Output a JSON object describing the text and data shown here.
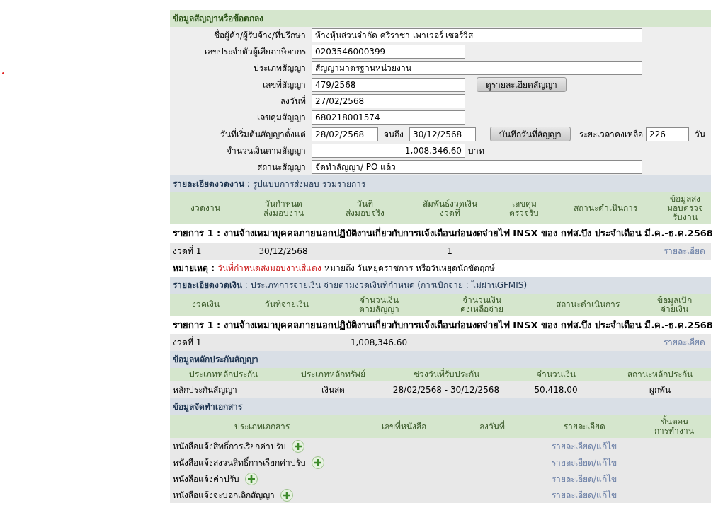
{
  "contract": {
    "title": "ข้อมูลสัญญาหรือข้อตกลง",
    "fields": [
      {
        "kind": "wide",
        "label": "ชื่อผู้ค้า/ผู้รับจ้าง/ที่ปรึกษา",
        "value": "ห้างหุ้นส่วนจำกัด ศรีราชา เพาเวอร์ เซอร์วิส"
      },
      {
        "kind": "narrow",
        "label": "เลขประจำตัวผู้เสียภาษีอากร",
        "value": "0203546000399"
      },
      {
        "kind": "wide",
        "label": "ประเภทสัญญา",
        "value": "สัญญามาตรฐานหน่วยงาน"
      },
      {
        "kind": "button",
        "label": "เลขที่สัญญา",
        "value": "479/2568",
        "button": "ดูรายละเอียดสัญญา"
      },
      {
        "kind": "narrow",
        "label": "ลงวันที่",
        "value": "27/02/2568"
      },
      {
        "kind": "narrow",
        "label": "เลขคุมสัญญา",
        "value": "680218001574"
      },
      {
        "kind": "range",
        "label": "วันที่เริ่มต้นสัญญาตั้งแต่",
        "value": "28/02/2568",
        "to_label": "จนถึง",
        "to_value": "30/12/2568",
        "button": "บันทึกวันที่สัญญา",
        "remaining_label": "ระยะเวลาคงเหลือ",
        "remaining_value": "226",
        "unit": "วัน"
      },
      {
        "kind": "amount",
        "label": "จำนวนเงินตามสัญญา",
        "value": "1,008,346.60",
        "unit": "บาท"
      },
      {
        "kind": "wide",
        "label": "สถานะสัญญา",
        "value": "จัดทำสัญญา/ PO แล้ว"
      }
    ]
  },
  "work": {
    "title": "รายละเอียดงวดงาน",
    "subtitle": ": รูปแบบการส่งมอบ รวมรายการ",
    "columns": [
      "งวดงาน",
      "วันกำหนด\nส่งมอบงาน",
      "วันที่\nส่งมอบจริง",
      "สัมพันธ์งวดเงิน\nงวดที่",
      "เลขคุม\nตรวจรับ",
      "สถานะดำเนินการ",
      "ข้อมูลส่ง\nมอบตรวจ\nรับงาน"
    ],
    "item_title": "รายการ 1 : งานจ้างเหมาบุคคลภายนอกปฏิบัติงานเกี่ยวกับการแจ้งเตือนก่อนงดจ่ายไฟ INSX ของ กฟส.บึง ประจำเดือน มี.ค.-ธ.ค.2568",
    "rows": [
      {
        "cells": [
          "งวดที่ 1",
          "30/12/2568",
          "",
          "1",
          "",
          ""
        ],
        "link": "รายละเอียด"
      }
    ]
  },
  "note": {
    "label": "หมายเหตุ :",
    "highlight": "วันที่กำหนดส่งมอบงานสีแดง",
    "text": "หมายถึง วันหยุดราชการ หรือวันหยุดนักขัตฤกษ์"
  },
  "payment": {
    "title": "รายละเอียดงวดเงิน",
    "subtitle": ": ประเภทการจ่ายเงิน จ่ายตามงวดเงินที่กำหนด (การเบิกจ่าย : ไม่ผ่านGFMIS)",
    "columns": [
      "งวดเงิน",
      "วันที่จ่ายเงิน",
      "จำนวนเงิน\nตามสัญญา",
      "จำนวนเงิน\nคงเหลือจ่าย",
      "สถานะดำเนินการ",
      "ข้อมูลเบิก\nจ่ายเงิน"
    ],
    "item_title": "รายการ 1 : งานจ้างเหมาบุคคลภายนอกปฏิบัติงานเกี่ยวกับการแจ้งเตือนก่อนงดจ่ายไฟ INSX ของ กฟส.บึง ประจำเดือน มี.ค.-ธ.ค.2568",
    "rows": [
      {
        "cells": [
          "งวดที่ 1",
          "",
          "1,008,346.60",
          "",
          ""
        ],
        "link": "รายละเอียด"
      }
    ]
  },
  "guarantee": {
    "title": "ข้อมูลหลักประกันสัญญา",
    "columns": [
      "ประเภทหลักประกัน",
      "ประเภทหลักทรัพย์",
      "ช่วงวันที่รับประกัน",
      "จำนวนเงิน",
      "สถานะหลักประกัน"
    ],
    "rows": [
      {
        "cells": [
          "หลักประกันสัญญา",
          "เงินสด",
          "28/02/2568 - 30/12/2568",
          "50,418.00",
          "ผูกพัน"
        ]
      }
    ]
  },
  "documents": {
    "title": "ข้อมูลจัดทำเอกสาร",
    "columns": [
      "ประเภทเอกสาร",
      "เลขที่หนังสือ",
      "ลงวันที่",
      "รายละเอียด",
      "ขั้นตอน\nการทำงาน"
    ],
    "rows": [
      {
        "name": "หนังสือแจ้งสิทธิ์การเรียกค่าปรับ",
        "link": "รายละเอียด/แก้ไข"
      },
      {
        "name": "หนังสือแจ้งสงวนสิทธิ์การเรียกค่าปรับ",
        "link": "รายละเอียด/แก้ไข"
      },
      {
        "name": "หนังสือแจ้งค่าปรับ",
        "link": "รายละเอียด/แก้ไข"
      },
      {
        "name": "หนังสือแจ้งจะบอกเลิกสัญญา",
        "link": "รายละเอียด/แก้ไข"
      }
    ]
  }
}
